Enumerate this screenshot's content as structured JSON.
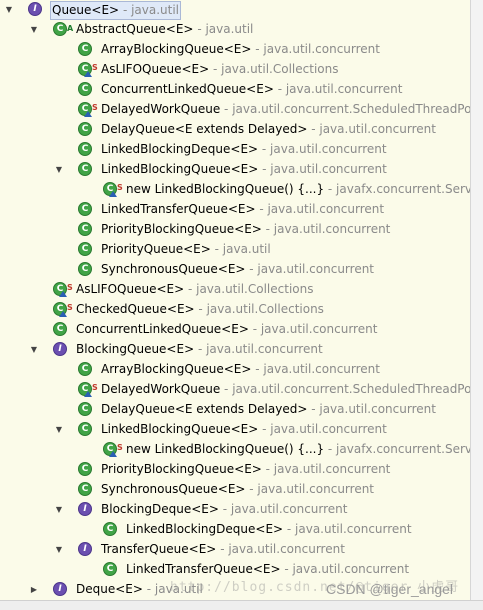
{
  "tree": {
    "rows": [
      {
        "depth": 0,
        "twisty": "down",
        "kind": "iface",
        "overlay": "",
        "name": "Queue<E>",
        "pkg": " - java.util",
        "selected": true
      },
      {
        "depth": 1,
        "twisty": "down",
        "kind": "class",
        "overlay": "A",
        "name": "AbstractQueue<E>",
        "pkg": " - java.util"
      },
      {
        "depth": 2,
        "twisty": "",
        "kind": "class",
        "overlay": "",
        "name": "ArrayBlockingQueue<E>",
        "pkg": " - java.util.concurrent"
      },
      {
        "depth": 2,
        "twisty": "",
        "kind": "class",
        "overlay": "S-tri",
        "name": "AsLIFOQueue<E>",
        "pkg": " - java.util.Collections"
      },
      {
        "depth": 2,
        "twisty": "",
        "kind": "class",
        "overlay": "",
        "name": "ConcurrentLinkedQueue<E>",
        "pkg": " - java.util.concurrent"
      },
      {
        "depth": 2,
        "twisty": "",
        "kind": "class",
        "overlay": "S-tri",
        "name": "DelayedWorkQueue",
        "pkg": " - java.util.concurrent.ScheduledThreadPoo"
      },
      {
        "depth": 2,
        "twisty": "",
        "kind": "class",
        "overlay": "",
        "name": "DelayQueue<E extends Delayed>",
        "pkg": " - java.util.concurrent"
      },
      {
        "depth": 2,
        "twisty": "",
        "kind": "class",
        "overlay": "",
        "name": "LinkedBlockingDeque<E>",
        "pkg": " - java.util.concurrent"
      },
      {
        "depth": 2,
        "twisty": "down",
        "kind": "class",
        "overlay": "",
        "name": "LinkedBlockingQueue<E>",
        "pkg": " - java.util.concurrent"
      },
      {
        "depth": 3,
        "twisty": "",
        "kind": "class",
        "overlay": "S-tri",
        "name": "new LinkedBlockingQueue() {...}",
        "pkg": " - javafx.concurrent.Service"
      },
      {
        "depth": 2,
        "twisty": "",
        "kind": "class",
        "overlay": "",
        "name": "LinkedTransferQueue<E>",
        "pkg": " - java.util.concurrent"
      },
      {
        "depth": 2,
        "twisty": "",
        "kind": "class",
        "overlay": "",
        "name": "PriorityBlockingQueue<E>",
        "pkg": " - java.util.concurrent"
      },
      {
        "depth": 2,
        "twisty": "",
        "kind": "class",
        "overlay": "",
        "name": "PriorityQueue<E>",
        "pkg": " - java.util"
      },
      {
        "depth": 2,
        "twisty": "",
        "kind": "class",
        "overlay": "",
        "name": "SynchronousQueue<E>",
        "pkg": " - java.util.concurrent"
      },
      {
        "depth": 1,
        "twisty": "",
        "kind": "class",
        "overlay": "S-tri",
        "name": "AsLIFOQueue<E>",
        "pkg": " - java.util.Collections"
      },
      {
        "depth": 1,
        "twisty": "",
        "kind": "class",
        "overlay": "S-tri",
        "name": "CheckedQueue<E>",
        "pkg": " - java.util.Collections"
      },
      {
        "depth": 1,
        "twisty": "",
        "kind": "class",
        "overlay": "",
        "name": "ConcurrentLinkedQueue<E>",
        "pkg": " - java.util.concurrent"
      },
      {
        "depth": 1,
        "twisty": "down",
        "kind": "iface",
        "overlay": "",
        "name": "BlockingQueue<E>",
        "pkg": " - java.util.concurrent"
      },
      {
        "depth": 2,
        "twisty": "",
        "kind": "class",
        "overlay": "",
        "name": "ArrayBlockingQueue<E>",
        "pkg": " - java.util.concurrent"
      },
      {
        "depth": 2,
        "twisty": "",
        "kind": "class",
        "overlay": "S-tri",
        "name": "DelayedWorkQueue",
        "pkg": " - java.util.concurrent.ScheduledThreadPoo"
      },
      {
        "depth": 2,
        "twisty": "",
        "kind": "class",
        "overlay": "",
        "name": "DelayQueue<E extends Delayed>",
        "pkg": " - java.util.concurrent"
      },
      {
        "depth": 2,
        "twisty": "down",
        "kind": "class",
        "overlay": "",
        "name": "LinkedBlockingQueue<E>",
        "pkg": " - java.util.concurrent"
      },
      {
        "depth": 3,
        "twisty": "",
        "kind": "class",
        "overlay": "S-tri",
        "name": "new LinkedBlockingQueue() {...}",
        "pkg": " - javafx.concurrent.Service"
      },
      {
        "depth": 2,
        "twisty": "",
        "kind": "class",
        "overlay": "",
        "name": "PriorityBlockingQueue<E>",
        "pkg": " - java.util.concurrent"
      },
      {
        "depth": 2,
        "twisty": "",
        "kind": "class",
        "overlay": "",
        "name": "SynchronousQueue<E>",
        "pkg": " - java.util.concurrent"
      },
      {
        "depth": 2,
        "twisty": "down",
        "kind": "iface",
        "overlay": "",
        "name": "BlockingDeque<E>",
        "pkg": " - java.util.concurrent"
      },
      {
        "depth": 3,
        "twisty": "",
        "kind": "class",
        "overlay": "",
        "name": "LinkedBlockingDeque<E>",
        "pkg": " - java.util.concurrent"
      },
      {
        "depth": 2,
        "twisty": "down",
        "kind": "iface",
        "overlay": "",
        "name": "TransferQueue<E>",
        "pkg": " - java.util.concurrent"
      },
      {
        "depth": 3,
        "twisty": "",
        "kind": "class",
        "overlay": "",
        "name": "LinkedTransferQueue<E>",
        "pkg": " - java.util.concurrent"
      },
      {
        "depth": 1,
        "twisty": "right",
        "kind": "iface",
        "overlay": "",
        "name": "Deque<E>",
        "pkg": " - java.util"
      }
    ]
  },
  "icons": {
    "class_letter": "C",
    "iface_letter": "I",
    "abstract_mark": "A",
    "static_mark": "S",
    "twisty_down": "▼",
    "twisty_right": "▶"
  },
  "colors": {
    "class": "#41a447",
    "interface": "#6b4fb0",
    "package_text": "#8a8a8a",
    "background": "#fbfbe9",
    "selection": "#dfe9f8"
  },
  "watermark": {
    "url": "http://blog.csdn.net/@tiger 小虎哥",
    "csdn": "CSDN @tiger_angel"
  }
}
